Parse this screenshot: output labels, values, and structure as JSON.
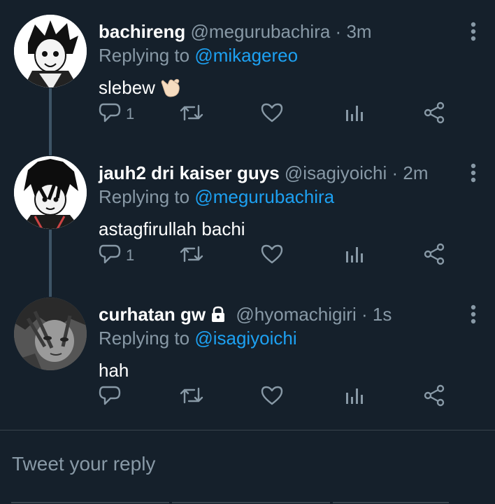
{
  "colors": {
    "background": "#15202b",
    "accent": "#1da1f2",
    "secondary": "#8899a6",
    "thread": "#3d5466"
  },
  "tweets": [
    {
      "name": "bachireng",
      "handle": "@megurubachira",
      "dot": "·",
      "time": "3m",
      "replying_prefix": "Replying to",
      "replying_to": "@mikagereo",
      "text": "slebew",
      "emoji_icon": "call-me-hand-icon",
      "reply_count": "1",
      "locked": false
    },
    {
      "name": "jauh2 dri kaiser guys",
      "handle": "@isagiyoichi",
      "dot": "·",
      "time": "2m",
      "replying_prefix": "Replying to",
      "replying_to": "@megurubachira",
      "text": "astagfirullah bachi",
      "reply_count": "1",
      "locked": false
    },
    {
      "name": "curhatan gw",
      "handle": "@hyomachigiri",
      "dot": "·",
      "time": "1s",
      "replying_prefix": "Replying to",
      "replying_to": "@isagiyoichi",
      "text": "hah",
      "reply_count": "",
      "locked": true
    }
  ],
  "composer": {
    "placeholder": "Tweet your reply"
  },
  "icons": [
    "reply-icon",
    "retweet-icon",
    "like-icon",
    "analytics-icon",
    "share-icon",
    "more-options-icon",
    "lock-icon"
  ]
}
